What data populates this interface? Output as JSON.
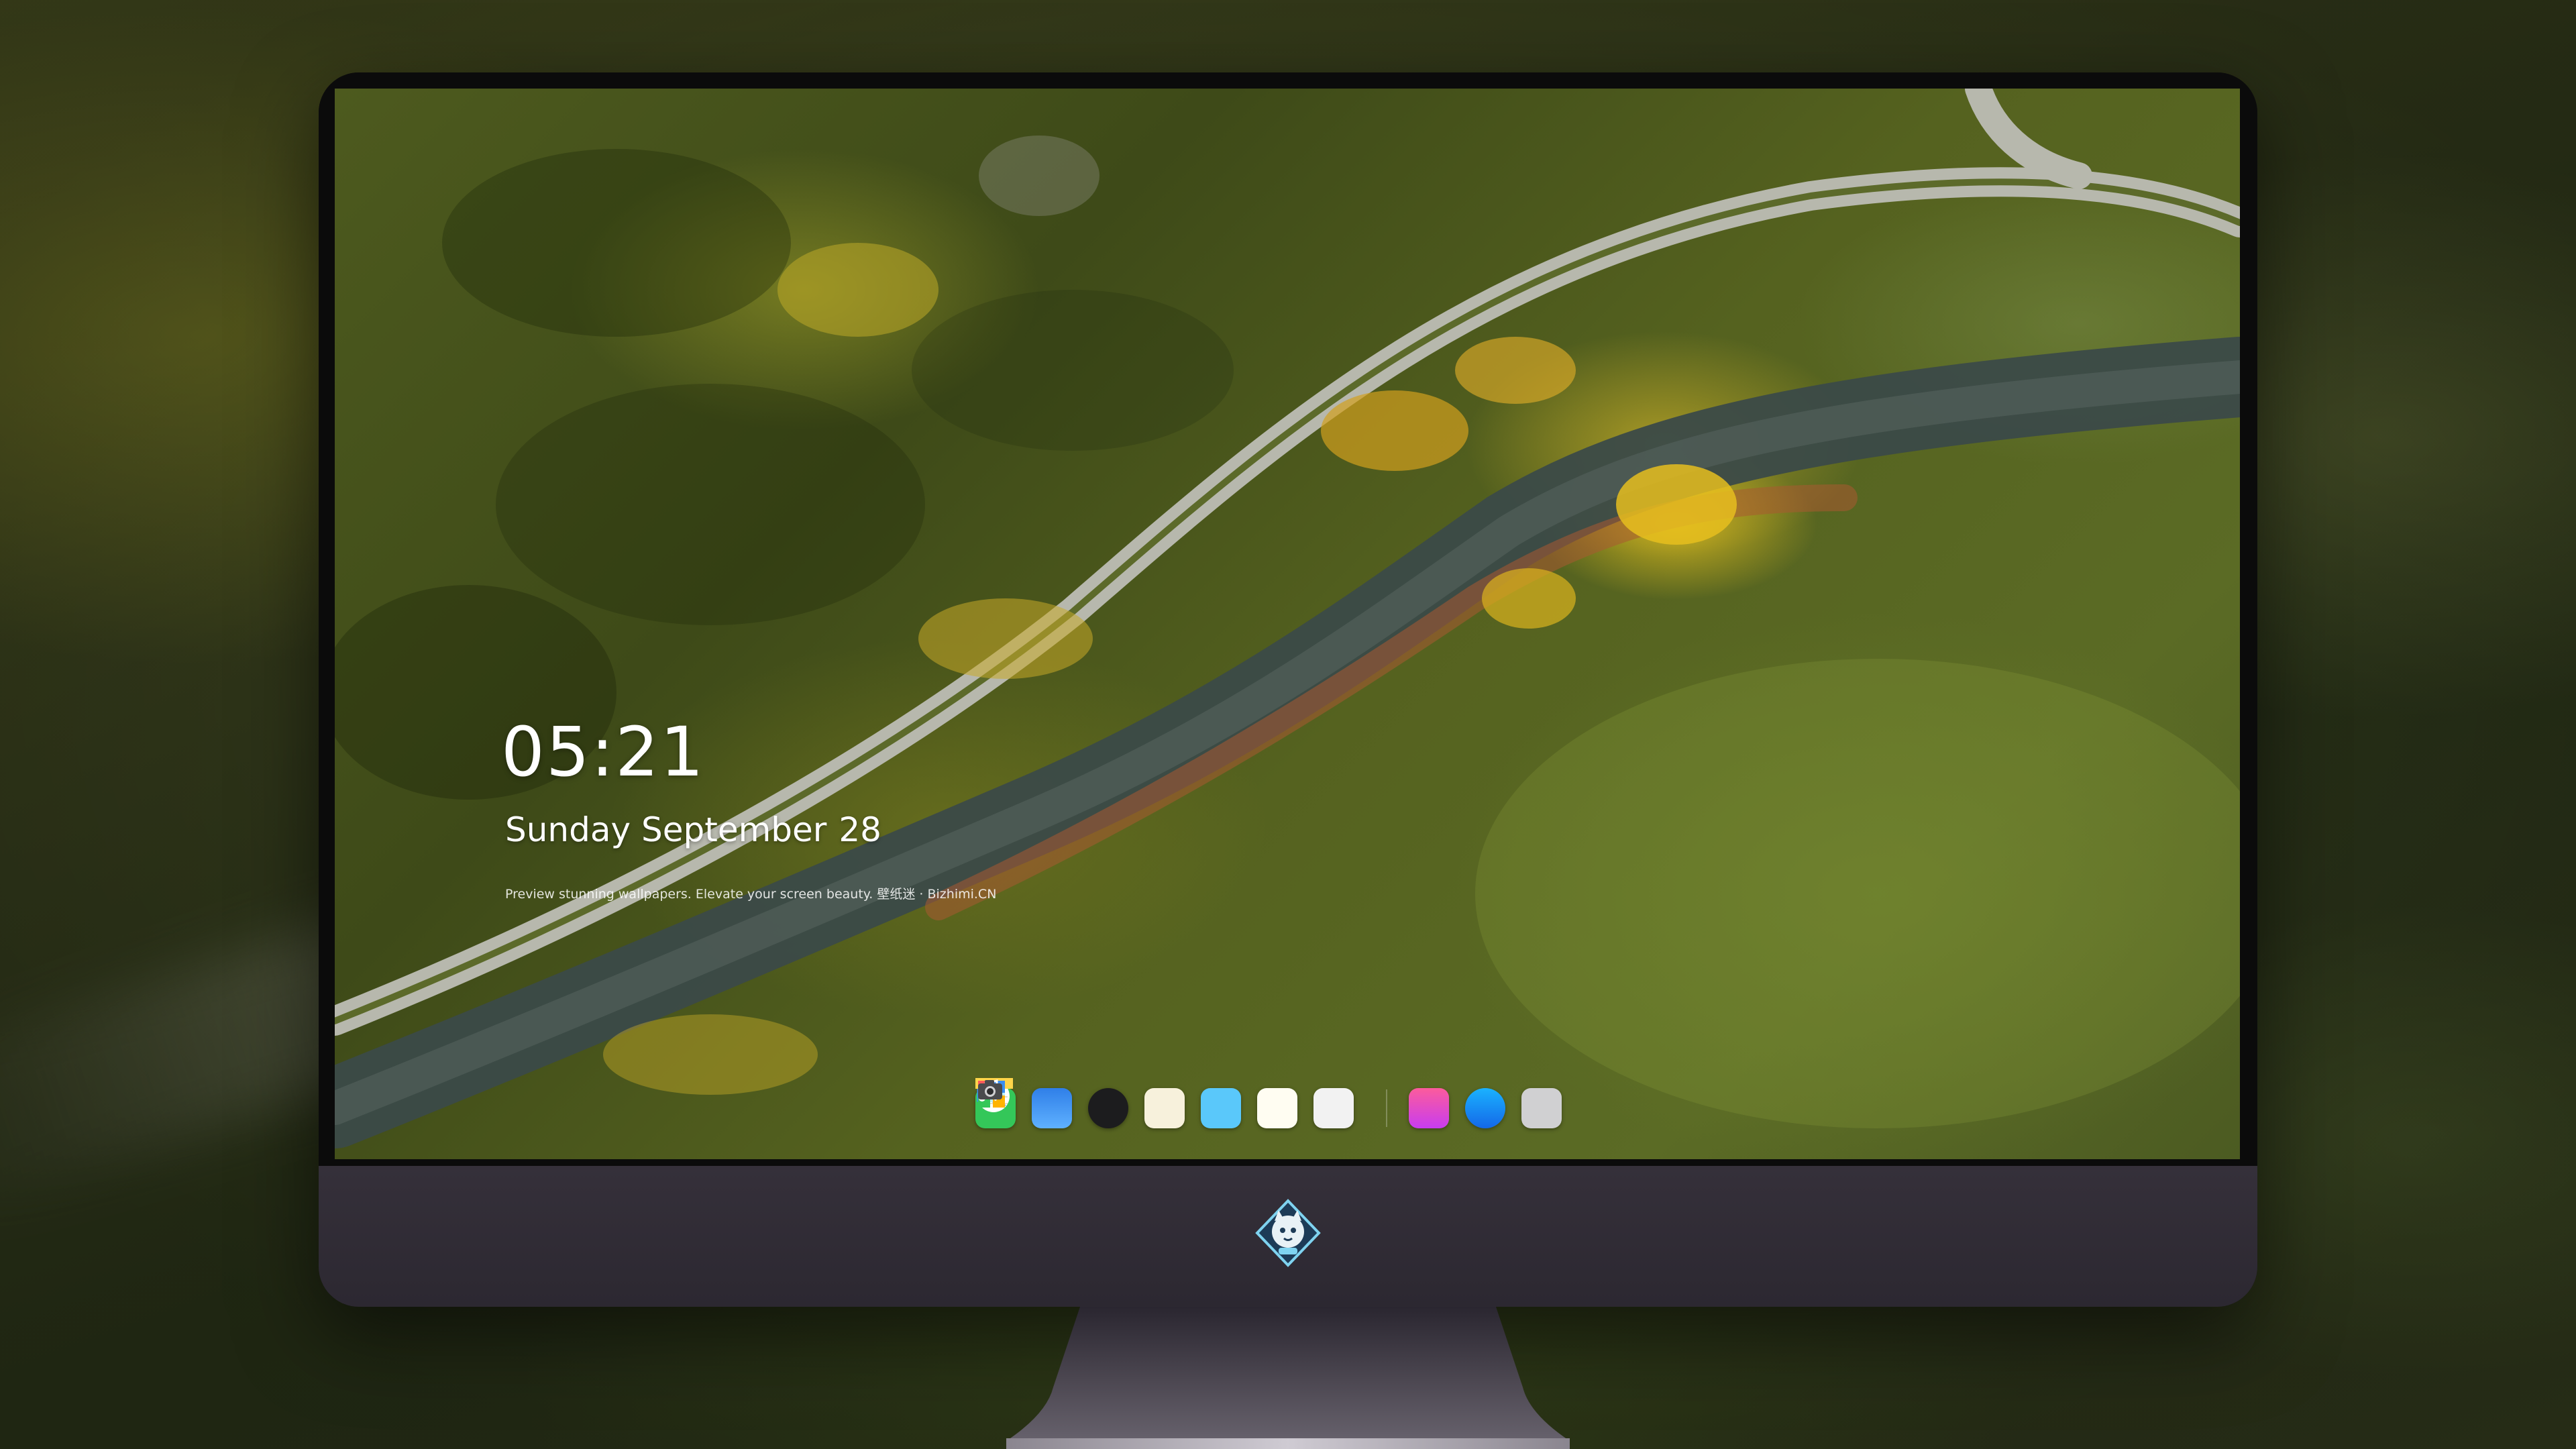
{
  "lock_screen": {
    "time": "05:21",
    "date_text": "Sunday September",
    "date_day": "28",
    "caption": "Preview stunning wallpapers. Elevate your screen beauty. 壁纸迷 · Bizhimi.CN"
  },
  "dock": {
    "apps": [
      {
        "name": "messages-icon",
        "color": "#34c759"
      },
      {
        "name": "weather-icon",
        "color": "#3a8ef0"
      },
      {
        "name": "clock-icon",
        "color": "#1c1c1e"
      },
      {
        "name": "preview-icon",
        "color": "#f3c33c"
      },
      {
        "name": "clips-icon",
        "color": "#5ac8fa"
      },
      {
        "name": "notes-icon",
        "color": "#ffd54a"
      },
      {
        "name": "photo-booth-icon",
        "color": "#ff5a5a"
      },
      {
        "name": "music-icon",
        "color": "#fc3c78"
      },
      {
        "name": "app-store-icon",
        "color": "#1e8bf5"
      },
      {
        "name": "camera-icon",
        "color": "#8e8e93"
      }
    ]
  },
  "colors": {
    "chin": "#2f2a33",
    "bezel": "#0b0b0b"
  }
}
